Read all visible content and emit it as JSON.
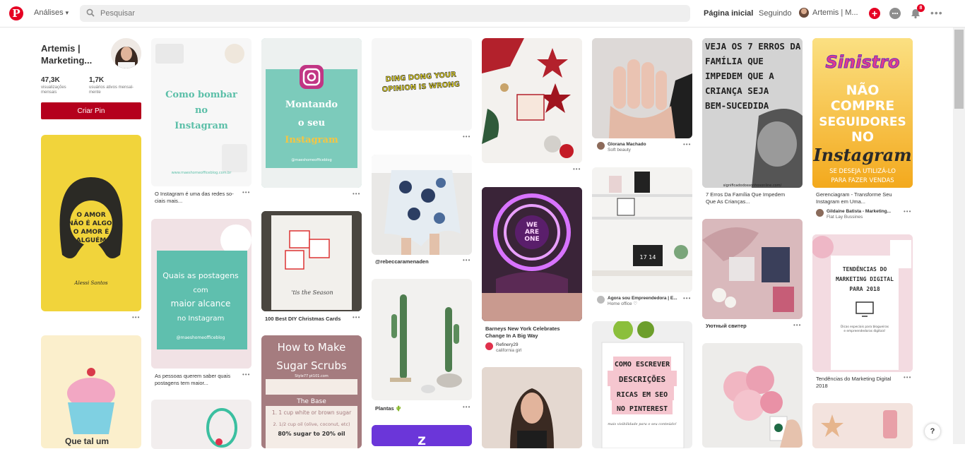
{
  "header": {
    "logo": "P",
    "analytics_label": "Análises",
    "search_placeholder": "Pesquisar",
    "home_label": "Página inicial",
    "following_label": "Seguindo",
    "profile_label": "Artemis | M...",
    "notifications_count": "8",
    "more_label": "•••"
  },
  "profile": {
    "name": "Artemis | Marketing...",
    "stats": [
      {
        "value": "47,3K",
        "label": "visualizações mensais"
      },
      {
        "value": "1,7K",
        "label": "usuários ativos mensal-mente"
      }
    ],
    "create_pin": "Criar Pin"
  },
  "pins": {
    "p1_quote": "O AMOR NÃO É ALGO, O AMOR É ALGUÉM",
    "p1_signature": "Alessi Santos",
    "p2_title": "Que tal um",
    "p3_title": "Como bombar no Instagram",
    "p3_url": "www.maeshomeofficeblog.com.br",
    "p3_caption": "O Instagram é uma das redes so-ciais mais...",
    "p4_title": "Quais as postagens com maior alcance no Instagram",
    "p4_handle": "@maeshomeofficeblog",
    "p4_caption": "As pessoas querem saber quais postagens tem maior...",
    "p5_title": "Montando o seu Instagram",
    "p5_handle": "@maeshomeofficeblog",
    "p6_text": "'tis the Season",
    "p6_caption": "100 Best DIY Christmas Cards",
    "p7_title": "How to Make Sugar Scrubs",
    "p7_sub": "Style77 pt101.com",
    "p7_base": "The Base",
    "p7_line1": "1. 1 cup white or brown sugar",
    "p7_line2": "2. 1/2 cup oil (olive, coconut, etc)",
    "p7_ratio": "80% sugar to 20% oil",
    "p8_text": "DING DONG YOUR OPINION IS WRONG",
    "p9_caption": "@rebeccaramenaden",
    "p10_caption": "Plantas",
    "p11_caption": "Barneys New York Celebrates Change In A Big Way",
    "p11_credit_name": "Refinery29",
    "p11_credit_sub": "california girl",
    "p12_neon": "WE ARE ONE",
    "p13_credit_name": "Glorana Machado",
    "p13_credit_sub": "Soft beauty",
    "p14_caption": "Agora sou Empreendedora | E...",
    "p14_sub": "Home office",
    "p14_clock": "17 14",
    "p15_title": "COMO ESCREVER DESCRIÇÕES RICAS EM SEO NO PINTEREST",
    "p15_sub": "mais visibilidade para o seu conteúdo!",
    "p16_title": "VEJA OS 7 ERROS DA FAMÍLIA QUE IMPEDEM QUE A CRIANÇA SEJA BEM-SUCEDIDA",
    "p16_url": "significadodossonhosonline.com/",
    "p16_caption": "7 Erros Da Família Que Impedem Que As Crianças...",
    "p17_caption": "Уютный свитер",
    "p19_brand": "Sinistro",
    "p19_title1": "NÃO COMPRE",
    "p19_title2": "SEGUIDORES NO",
    "p19_title3": "Instagram",
    "p19_sub": "SE DESEJA UTILIZÁ-LO PARA FAZER VENDAS",
    "p19_caption": "Gerenciagram - Transforme Seu Instagram em Uma...",
    "p19_credit_name": "Gildaine Batista - Marketing...",
    "p19_credit_sub": "Flat Lay Bussines",
    "p20_title": "TENDÊNCIAS DO MARKETING DIGITAL PARA 2018",
    "p20_sub": "Dicas especiais para blogueiras e empreendedoras digitais!",
    "p20_caption": "Tendências do Marketing Digital 2018",
    "more_dots": "•••"
  },
  "help_label": "?"
}
